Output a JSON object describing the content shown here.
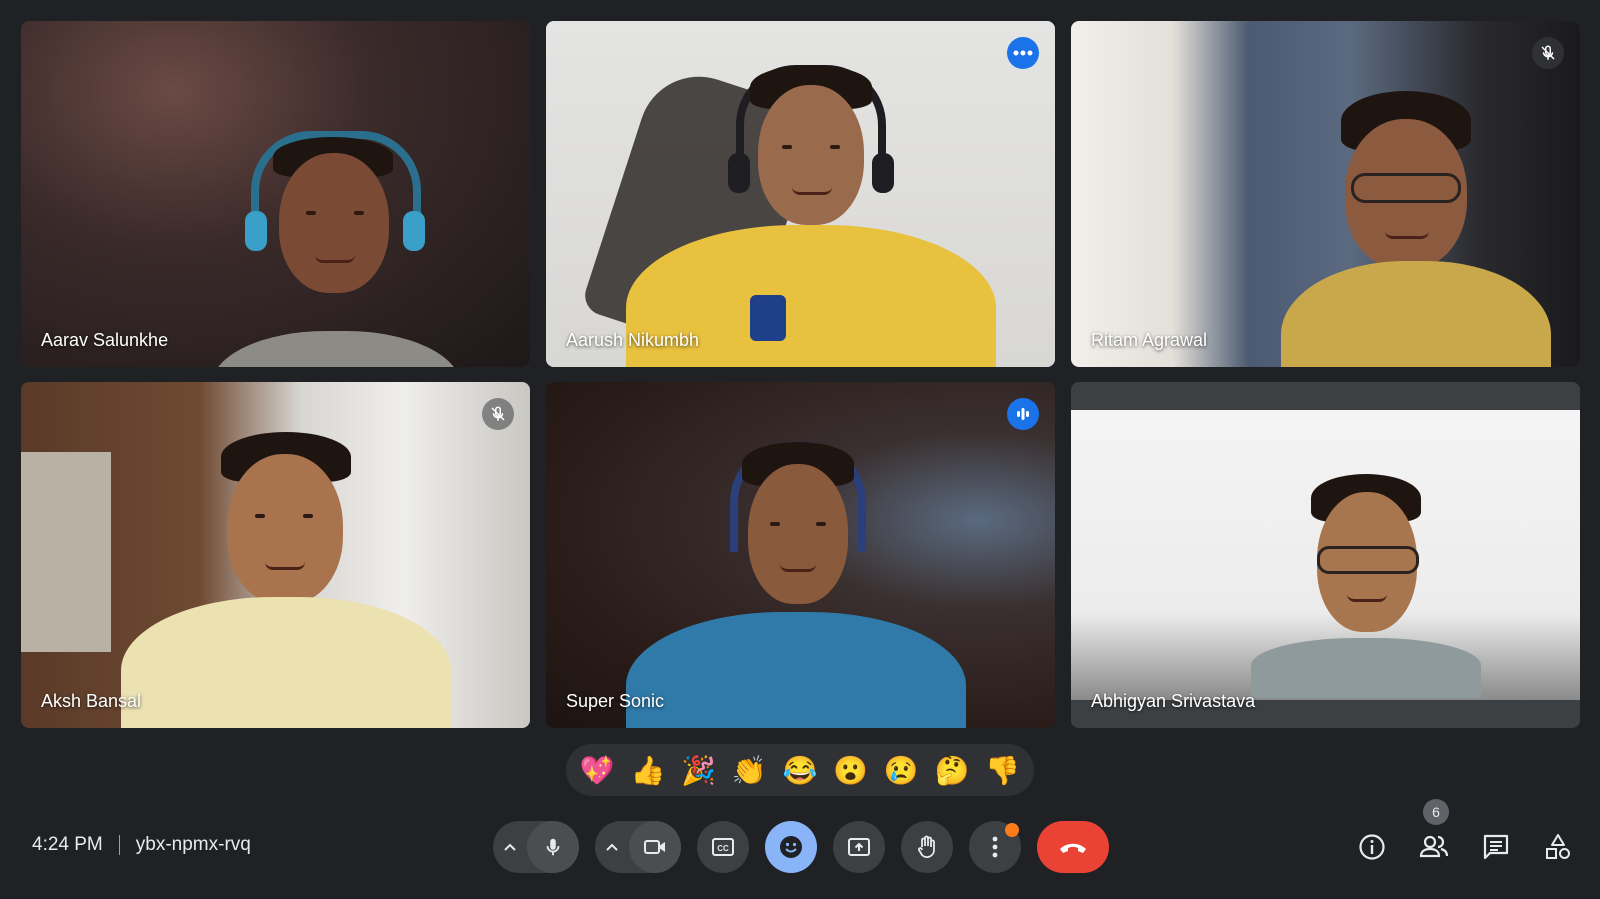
{
  "participants": [
    {
      "name": "Aarav Salunkhe",
      "status": "none"
    },
    {
      "name": "Aarush Nikumbh",
      "status": "more-options"
    },
    {
      "name": "Ritam Agrawal",
      "status": "muted"
    },
    {
      "name": "Aksh Bansal",
      "status": "muted"
    },
    {
      "name": "Super Sonic",
      "status": "speaking"
    },
    {
      "name": "Abhigyan Srivastava",
      "status": "none"
    }
  ],
  "reactions": [
    "💖",
    "👍",
    "🎉",
    "👏",
    "😂",
    "😮",
    "😢",
    "🤔",
    "👎"
  ],
  "meeting": {
    "time": "4:24 PM",
    "code": "ybx-npmx-rvq"
  },
  "people_count": "6",
  "colors": {
    "accent": "#8ab4f8",
    "end_call": "#ea4335",
    "notification_dot": "#fa7b17",
    "speaking_badge": "#1a73e8"
  }
}
